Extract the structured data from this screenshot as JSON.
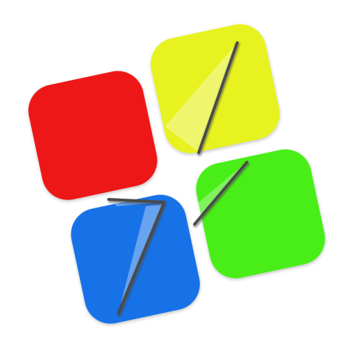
{
  "logo": {
    "tiles": [
      {
        "name": "red-tile",
        "color": "#ee1111"
      },
      {
        "name": "yellow-tile",
        "color": "#e7f216"
      },
      {
        "name": "blue-tile",
        "color": "#0f6ee8"
      },
      {
        "name": "green-tile",
        "color": "#41ee10"
      }
    ],
    "stroke_color": "#4a4a4a",
    "highlight_color": "#ffffff"
  }
}
